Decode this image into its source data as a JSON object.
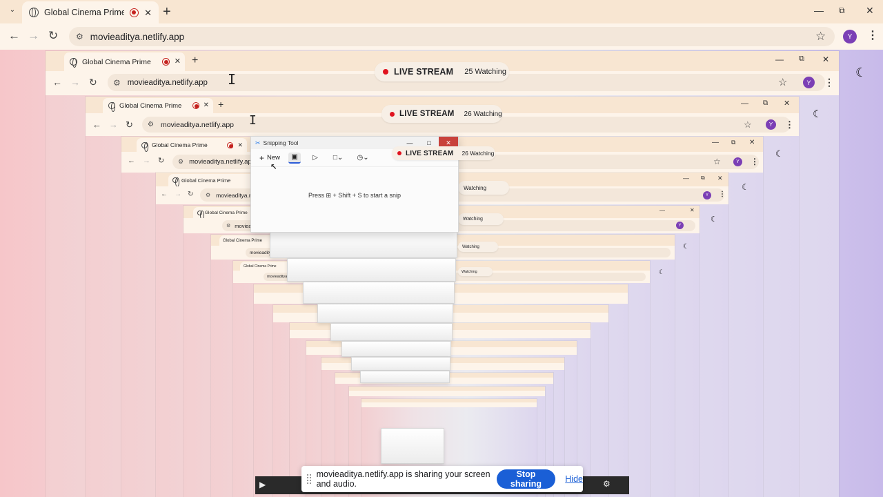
{
  "tab": {
    "title": "Global Cinema Prime"
  },
  "address": {
    "url": "movieaditya.netlify.app"
  },
  "profile": {
    "initial": "Y"
  },
  "live_stream": {
    "label": "LIVE STREAM",
    "outer_watching": "25 Watching",
    "inner_watching": "26 Watching",
    "snip_watching": "26 Watching",
    "faded_watching": "Watching"
  },
  "snipping_tool": {
    "title": "Snipping Tool",
    "new_label": "New",
    "hint": "Press ⊞ + Shift + S to start a snip"
  },
  "share_bar": {
    "message": "movieaditya.netlify.app is sharing your screen and audio.",
    "stop_label": "Stop sharing",
    "hide_label": "Hide"
  },
  "icons": {
    "moon": "moon-icon",
    "star": "star-icon",
    "reload": "reload-icon",
    "back": "back-arrow-icon",
    "forward": "forward-arrow-icon",
    "close": "close-icon",
    "minimize": "minimize-icon",
    "restore": "restore-icon",
    "record": "recording-indicator-icon"
  },
  "colors": {
    "accent_blue": "#1a5fd6",
    "live_red": "#e0131f",
    "profile_purple": "#7b3fb5",
    "record_red": "#c5221f"
  }
}
